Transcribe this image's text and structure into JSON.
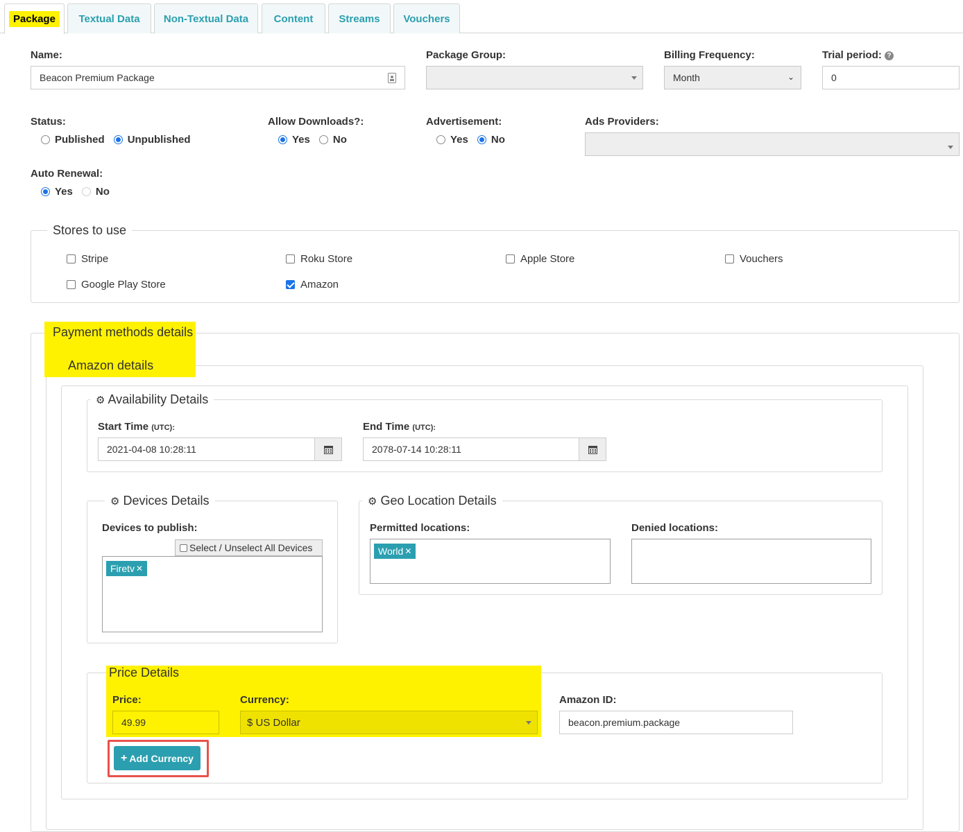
{
  "tabs": [
    {
      "label": "Package",
      "active": true
    },
    {
      "label": "Textual Data"
    },
    {
      "label": "Non-Textual Data"
    },
    {
      "label": "Content"
    },
    {
      "label": "Streams"
    },
    {
      "label": "Vouchers"
    }
  ],
  "form": {
    "name_label": "Name:",
    "name_value": "Beacon Premium Package",
    "package_group_label": "Package Group:",
    "package_group_value": "",
    "billing_label": "Billing Frequency:",
    "billing_value": "Month",
    "trial_label": "Trial period:",
    "trial_value": "0",
    "status_label": "Status:",
    "status_published": "Published",
    "status_unpublished": "Unpublished",
    "status_selected": "Unpublished",
    "downloads_label": "Allow Downloads?:",
    "downloads_yes": "Yes",
    "downloads_no": "No",
    "downloads_selected": "Yes",
    "ad_label": "Advertisement:",
    "ad_yes": "Yes",
    "ad_no": "No",
    "ad_selected": "No",
    "ads_providers_label": "Ads Providers:",
    "auto_renewal_label": "Auto Renewal:",
    "auto_yes": "Yes",
    "auto_no": "No",
    "auto_selected": "Yes"
  },
  "stores": {
    "legend": "Stores to use",
    "items": [
      {
        "label": "Stripe",
        "checked": false
      },
      {
        "label": "Roku Store",
        "checked": false
      },
      {
        "label": "Apple Store",
        "checked": false
      },
      {
        "label": "Vouchers",
        "checked": false
      },
      {
        "label": "Google Play Store",
        "checked": false
      },
      {
        "label": "Amazon",
        "checked": true
      }
    ]
  },
  "payment": {
    "legend": "Payment methods details",
    "amazon_legend": "Amazon details",
    "availability": {
      "legend": "Availability Details",
      "start_label": "Start Time",
      "start_unit": "(UTC):",
      "start_value": "2021-04-08 10:28:11",
      "end_label": "End Time",
      "end_unit": "(UTC):",
      "end_value": "2078-07-14 10:28:11"
    },
    "devices": {
      "legend": "Devices Details",
      "publish_label": "Devices to publish:",
      "select_all_label": "Select / Unselect All Devices",
      "selected": [
        "Firetv"
      ]
    },
    "geo": {
      "legend": "Geo Location Details",
      "permitted_label": "Permitted locations:",
      "permitted": [
        "World"
      ],
      "denied_label": "Denied locations:"
    },
    "price": {
      "legend": "Price Details",
      "price_label": "Price:",
      "price_value": "49.99",
      "currency_label": "Currency:",
      "currency_value": "$ US Dollar",
      "amazon_id_label": "Amazon ID:",
      "amazon_id_value": "beacon.premium.package",
      "add_currency_label": "Add Currency"
    }
  },
  "colors": {
    "accent": "#2b9fb0",
    "highlight": "#fff200",
    "callout": "#e8524a",
    "radio": "#1a73e8"
  }
}
